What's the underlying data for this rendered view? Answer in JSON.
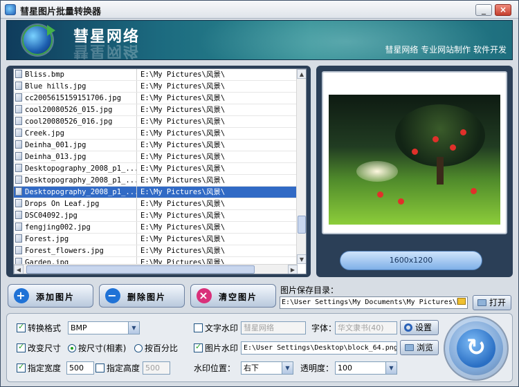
{
  "window": {
    "title": "彗星图片批量转换器",
    "min_label": "_",
    "max_label": "□",
    "close_label": "×"
  },
  "banner": {
    "brand": "彗星网络",
    "tagline": "彗星网络  专业网站制作  软件开发"
  },
  "file_list": {
    "rows": [
      {
        "name": "Bliss.bmp",
        "path": "E:\\My Pictures\\风景\\"
      },
      {
        "name": "Blue hills.jpg",
        "path": "E:\\My Pictures\\风景\\"
      },
      {
        "name": "cc2005615159151706.jpg",
        "path": "E:\\My Pictures\\风景\\"
      },
      {
        "name": "cool20080526_015.jpg",
        "path": "E:\\My Pictures\\风景\\"
      },
      {
        "name": "cool20080526_016.jpg",
        "path": "E:\\My Pictures\\风景\\"
      },
      {
        "name": "Creek.jpg",
        "path": "E:\\My Pictures\\风景\\"
      },
      {
        "name": "Deinha_001.jpg",
        "path": "E:\\My Pictures\\风景\\"
      },
      {
        "name": "Deinha_013.jpg",
        "path": "E:\\My Pictures\\风景\\"
      },
      {
        "name": "Desktopography_2008_p1_...",
        "path": "E:\\My Pictures\\风景\\"
      },
      {
        "name": "Desktopography_2008_p1_...",
        "path": "E:\\My Pictures\\风景\\"
      },
      {
        "name": "Desktopography_2008_p1_...",
        "path": "E:\\My Pictures\\风景\\"
      },
      {
        "name": "Drops On Leaf.jpg",
        "path": "E:\\My Pictures\\风景\\"
      },
      {
        "name": "DSC04092.jpg",
        "path": "E:\\My Pictures\\风景\\"
      },
      {
        "name": "fengjing002.jpg",
        "path": "E:\\My Pictures\\风景\\"
      },
      {
        "name": "Forest.jpg",
        "path": "E:\\My Pictures\\风景\\"
      },
      {
        "name": "Forest_flowers.jpg",
        "path": "E:\\My Pictures\\风景\\"
      },
      {
        "name": "Garden.jpg",
        "path": "E:\\My Pictures\\风景\\"
      }
    ],
    "selected_index": 10
  },
  "preview": {
    "dimensions": "1600x1200"
  },
  "buttons": {
    "add": "添加图片",
    "delete": "删除图片",
    "clear": "清空图片",
    "open": "打开",
    "settings": "设置",
    "browse": "浏览"
  },
  "save_dir": {
    "label": "图片保存目录：",
    "value": "E:\\User Settings\\My Documents\\My Pictures\\图"
  },
  "options": {
    "convert_format_label": "转换格式",
    "convert_format_value": "BMP",
    "resize_label": "改变尺寸",
    "by_size_label": "按尺寸(相素)",
    "by_percent_label": "按百分比",
    "width_label": "指定宽度",
    "width_value": "500",
    "height_label": "指定高度",
    "height_value": "500",
    "text_watermark_label": "文字水印",
    "text_watermark_value": "彗星网络",
    "font_label": "字体：",
    "font_value": "华文隶书(40)",
    "image_watermark_label": "图片水印",
    "image_watermark_value": "E:\\User Settings\\Desktop\\block_64.png",
    "position_label": "水印位置：",
    "position_value": "右下",
    "opacity_label": "透明度：",
    "opacity_value": "100"
  },
  "colors": {
    "selection": "#316ac5",
    "check": "#21a121",
    "panel_dark": "#2b3f57"
  }
}
